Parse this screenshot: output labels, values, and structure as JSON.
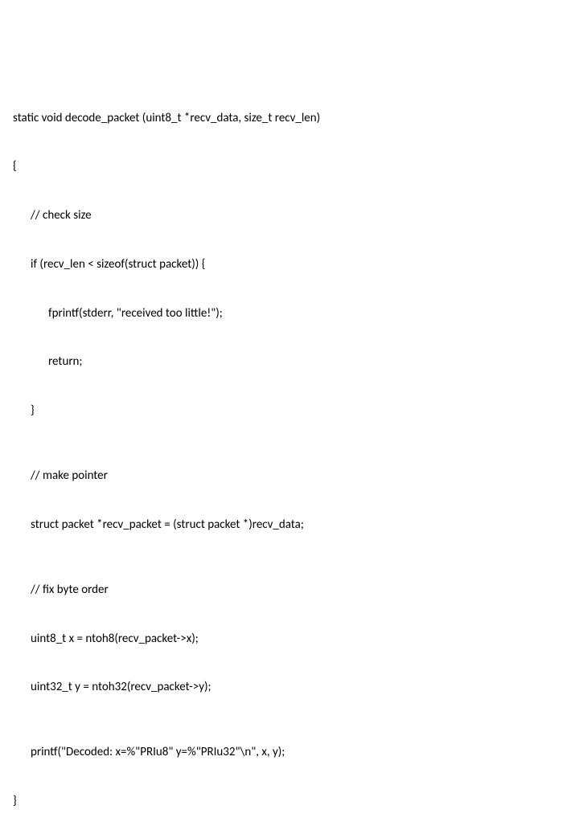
{
  "code": {
    "l0": "static void decode_packet (uint8_t *recv_data, size_t recv_len)",
    "l1": "{",
    "l2": "// check size",
    "l3": "if (recv_len < sizeof(struct packet)) {",
    "l4": "fprintf(stderr, \"received too little!\");",
    "l5": "return;",
    "l6": "}",
    "l7": "// make pointer",
    "l8": "struct packet *recv_packet = (struct packet *)recv_data;",
    "l9": "// fix byte order",
    "l10": "uint8_t x = ntoh8(recv_packet->x);",
    "l11": "uint32_t y = ntoh32(recv_packet->y);",
    "l12": "printf(\"Decoded: x=%\"PRIu8\" y=%\"PRIu32\"\\n\", x, y);",
    "l13": "}"
  }
}
